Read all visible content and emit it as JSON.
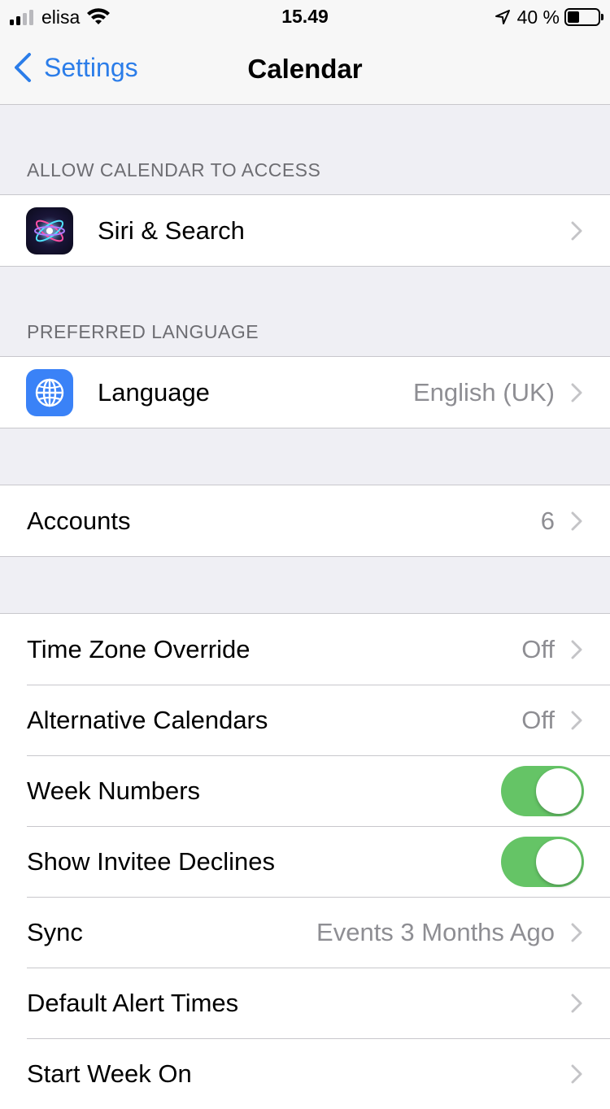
{
  "status_bar": {
    "carrier": "elisa",
    "time": "15.49",
    "battery": "40 %",
    "icons": [
      "signal-icon",
      "wifi-icon",
      "location-arrow-icon",
      "battery-icon"
    ]
  },
  "nav": {
    "back_label": "Settings",
    "title": "Calendar"
  },
  "sections": {
    "access_header": "ALLOW CALENDAR TO ACCESS",
    "siri": {
      "label": "Siri & Search",
      "icon": "siri-icon"
    },
    "language_header": "PREFERRED LANGUAGE",
    "language": {
      "label": "Language",
      "value": "English (UK)",
      "icon": "globe-icon"
    },
    "accounts": {
      "label": "Accounts",
      "value": "6"
    },
    "time_zone": {
      "label": "Time Zone Override",
      "value": "Off"
    },
    "alt_calendars": {
      "label": "Alternative Calendars",
      "value": "Off"
    },
    "week_numbers": {
      "label": "Week Numbers",
      "on": true
    },
    "invitee_declines": {
      "label": "Show Invitee Declines",
      "on": true
    },
    "sync": {
      "label": "Sync",
      "value": "Events 3 Months Ago"
    },
    "alert_times": {
      "label": "Default Alert Times"
    },
    "start_week": {
      "label": "Start Week On"
    }
  },
  "colors": {
    "accent": "#2b7de9",
    "toggle_on": "#65c466",
    "background": "#efeff4",
    "secondary_text": "#8e8e93"
  }
}
